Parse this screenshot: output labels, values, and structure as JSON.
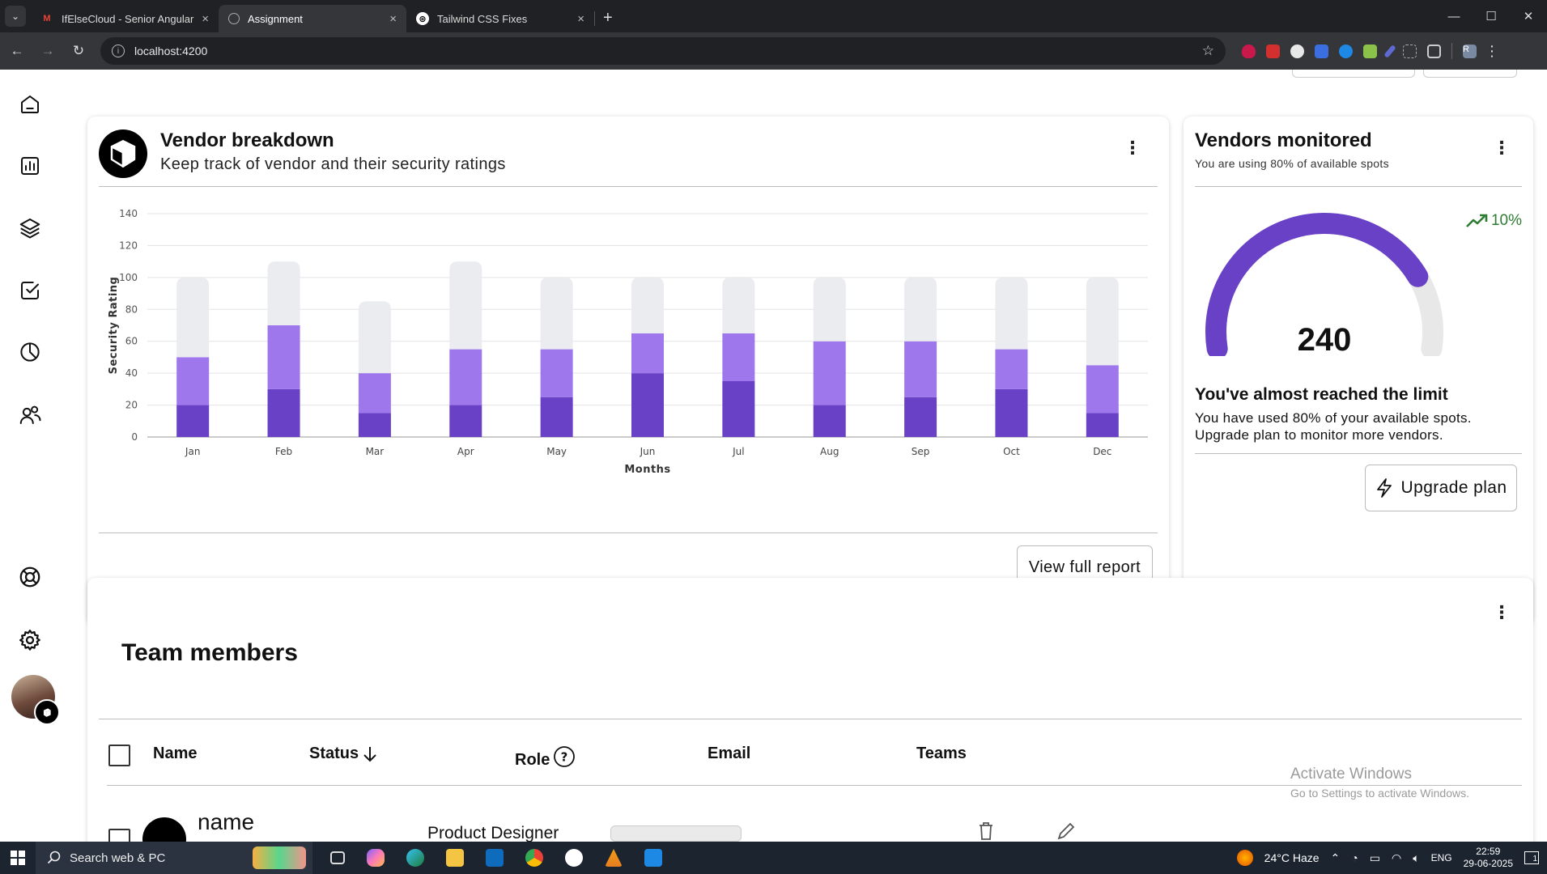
{
  "browser": {
    "tabs": [
      {
        "title": "IfElseCloud - Senior Angular De",
        "favicon": "gmail-icon"
      },
      {
        "title": "Assignment",
        "favicon": "globe-icon"
      },
      {
        "title": "Tailwind CSS Fixes",
        "favicon": "openai-icon"
      }
    ],
    "url": "localhost:4200",
    "profile_initial": "R"
  },
  "sidebar": {
    "nav": [
      "home-icon",
      "bar-chart-icon",
      "layers-icon",
      "check-square-icon",
      "pie-chart-icon",
      "users-icon"
    ],
    "bottom": [
      "support-icon",
      "settings-icon"
    ]
  },
  "vendor_breakdown": {
    "title": "Vendor breakdown",
    "subtitle": "Keep track of vendor and their security ratings",
    "view_report_label": "View full report"
  },
  "chart_data": {
    "type": "bar",
    "stacked": true,
    "categories": [
      "Jan",
      "Feb",
      "Mar",
      "Apr",
      "May",
      "Jun",
      "Jul",
      "Aug",
      "Sep",
      "Oct",
      "Dec"
    ],
    "series": [
      {
        "values": [
          20,
          30,
          15,
          20,
          25,
          40,
          35,
          20,
          25,
          30,
          15
        ],
        "color": "#6941c6"
      },
      {
        "values": [
          30,
          40,
          25,
          35,
          30,
          25,
          30,
          40,
          35,
          25,
          30
        ],
        "color": "#9e77ed"
      },
      {
        "values": [
          50,
          40,
          45,
          55,
          45,
          35,
          35,
          40,
          40,
          45,
          55
        ],
        "color": "#eaecf0"
      }
    ],
    "xlabel": "Months",
    "ylabel": "Security Rating",
    "ylim": [
      0,
      140
    ],
    "yticks": [
      0,
      20,
      40,
      60,
      80,
      100,
      120,
      140
    ],
    "grid": true
  },
  "vendors_monitored": {
    "title": "Vendors monitored",
    "subtitle": "You are using 80% of available spots",
    "value": "240",
    "usage_fraction": 0.8,
    "trend": "10%",
    "limit_title": "You've almost reached the limit",
    "limit_text": "You have used 80% of your available spots. Upgrade plan to monitor more vendors.",
    "upgrade_label": "Upgrade plan"
  },
  "team": {
    "title": "Team members",
    "columns": {
      "name": "Name",
      "status": "Status",
      "role": "Role",
      "email": "Email",
      "teams": "Teams"
    },
    "row": {
      "name": "name",
      "role": "Product Designer"
    }
  },
  "watermark": {
    "line1": "Activate Windows",
    "line2": "Go to Settings to activate Windows."
  },
  "taskbar": {
    "search_placeholder": "Search web & PC",
    "weather": "24°C  Haze",
    "lang": "ENG",
    "time": "22:59",
    "date": "29-06-2025",
    "notifications": "1"
  }
}
